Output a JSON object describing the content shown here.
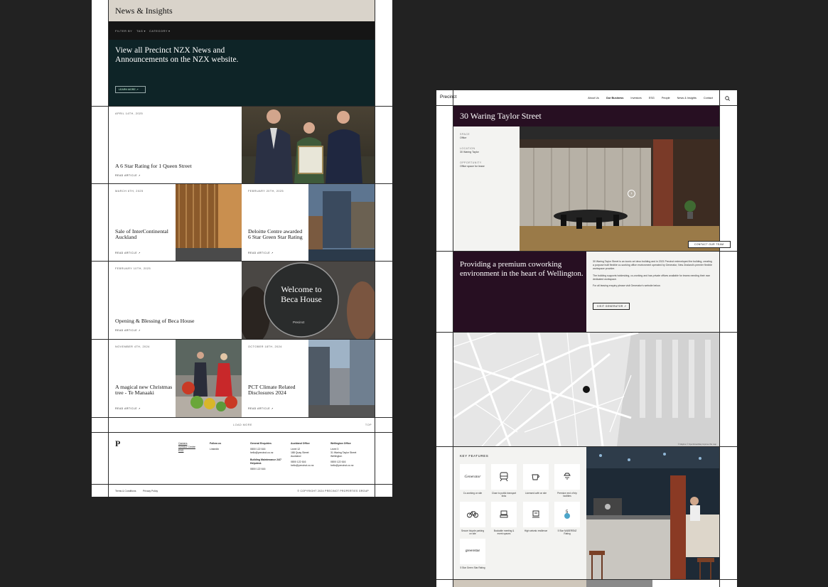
{
  "news_page": {
    "title": "News & Insights",
    "filter": {
      "label": "FILTER BY",
      "tag": "TAG",
      "category": "CATEGORY"
    },
    "nzx": {
      "text": "View all Precinct NZX News and Announcements on the NZX website.",
      "button": "LEARN MORE"
    },
    "articles": [
      {
        "date": "APRIL 14TH, 2025",
        "title": "A 6 Star Rating for 1 Queen Street",
        "link": "READ ARTICLE"
      },
      {
        "date": "MARCH 6TH, 2025",
        "title": "Sale of InterContinental Auckland",
        "link": "READ ARTICLE"
      },
      {
        "date": "FEBRUARY 20TH, 2025",
        "title": "Deloitte Centre awarded 6 Star Green Star Rating",
        "link": "READ ARTICLE"
      },
      {
        "date": "FEBRUARY 10TH, 2025",
        "title": "Opening & Blessing of Beca House",
        "link": "READ ARTICLE"
      },
      {
        "date": "NOVEMBER 4TH, 2024",
        "title": "A magical new Christmas tree - Te Manaaki",
        "link": "READ ARTICLE"
      },
      {
        "date": "OCTOBER 18TH, 2024",
        "title": "PCT Climate Related Disclosures 2024",
        "link": "READ ARTICLE"
      }
    ],
    "beca_sign": {
      "line1": "Welcome to",
      "line2": "Beca House",
      "brand": "Precinct"
    },
    "load_more": "LOAD MORE",
    "top": "TOP",
    "footer": {
      "links": [
        "Careers",
        "Investor Centre",
        "ESG"
      ],
      "follow": {
        "heading": "Follow us",
        "item": "LinkedIn"
      },
      "general": {
        "heading": "General Enquiries",
        "phone": "0800 122 616",
        "email": "hello@precinct.co.nz",
        "maint_heading": "Building Maintenance 24/7 Helpdesk",
        "maint_phone": "0800 122 616"
      },
      "auckland": {
        "heading": "Auckland Office",
        "l1": "Level 12",
        "l2": "188 Quay Street",
        "l3": "Auckland",
        "phone": "0800 122 616",
        "email": "hello@precinct.co.nz"
      },
      "wellington": {
        "heading": "Wellington Office",
        "l1": "Level 3",
        "l2": "31 Waring Taylor Street",
        "l3": "Wellington",
        "phone": "0800 122 616",
        "email": "hello@precinct.co.nz"
      },
      "terms": "Terms & Conditions",
      "privacy": "Privacy Policy",
      "copyright": "© COPYRIGHT 2024 PRECINCT PROPERTIES GROUP"
    }
  },
  "property_page": {
    "logo": "Precinct",
    "nav": [
      "About Us",
      "Our Business",
      "Investors",
      "ESG",
      "People",
      "News & Insights",
      "Contact"
    ],
    "title": "30 Waring Taylor Street",
    "meta": [
      {
        "key": "SPACE",
        "value": "Office"
      },
      {
        "key": "LOCATION",
        "value": "30 Waring Taylor"
      },
      {
        "key": "OPPORTUNITY",
        "value": "Office space for lease"
      }
    ],
    "contact_button": "CONTACT OUR TEAM",
    "cowork_heading": "Providing a premium coworking environment in the heart of Wellington.",
    "cowork_p1": "30 Waring Taylor Street is an iconic art deco building and in 2021 Precinct redeveloped the building, creating a purpose built flexible co-working office environment operated by Generator, New Zealand's premier flexible workspace provider.",
    "cowork_p2": "The building supports hotdesking, co-working and has private offices available for teams needing their own dedicated workspace.",
    "cowork_p3": "For all leasing enquiry please visit Generator's website below.",
    "visit_button": "VISIT GENERATOR",
    "map_credit": "© Mapbox © OpenStreetMap Improve this map",
    "features_heading": "KEY FEATURES",
    "features": [
      {
        "icon": "Generator",
        "label": "Co-working on site"
      },
      {
        "icon": "train-icon",
        "label": "Close to public transport links"
      },
      {
        "icon": "coffee-icon",
        "label": "Licensed café on site"
      },
      {
        "icon": "shower-icon",
        "label": "Premium end of trip facilities"
      },
      {
        "icon": "bike-icon",
        "label": "Secure bicycle parking on site"
      },
      {
        "icon": "meeting-icon",
        "label": "Bookable meeting & event spaces"
      },
      {
        "icon": "seismic-icon",
        "label": "High seismic resilience"
      },
      {
        "icon": "nabersnz-icon",
        "label": "5 Star NABERSNZ Rating"
      },
      {
        "icon": "greenstar",
        "label": "5 Star Green Star Rating"
      }
    ]
  }
}
